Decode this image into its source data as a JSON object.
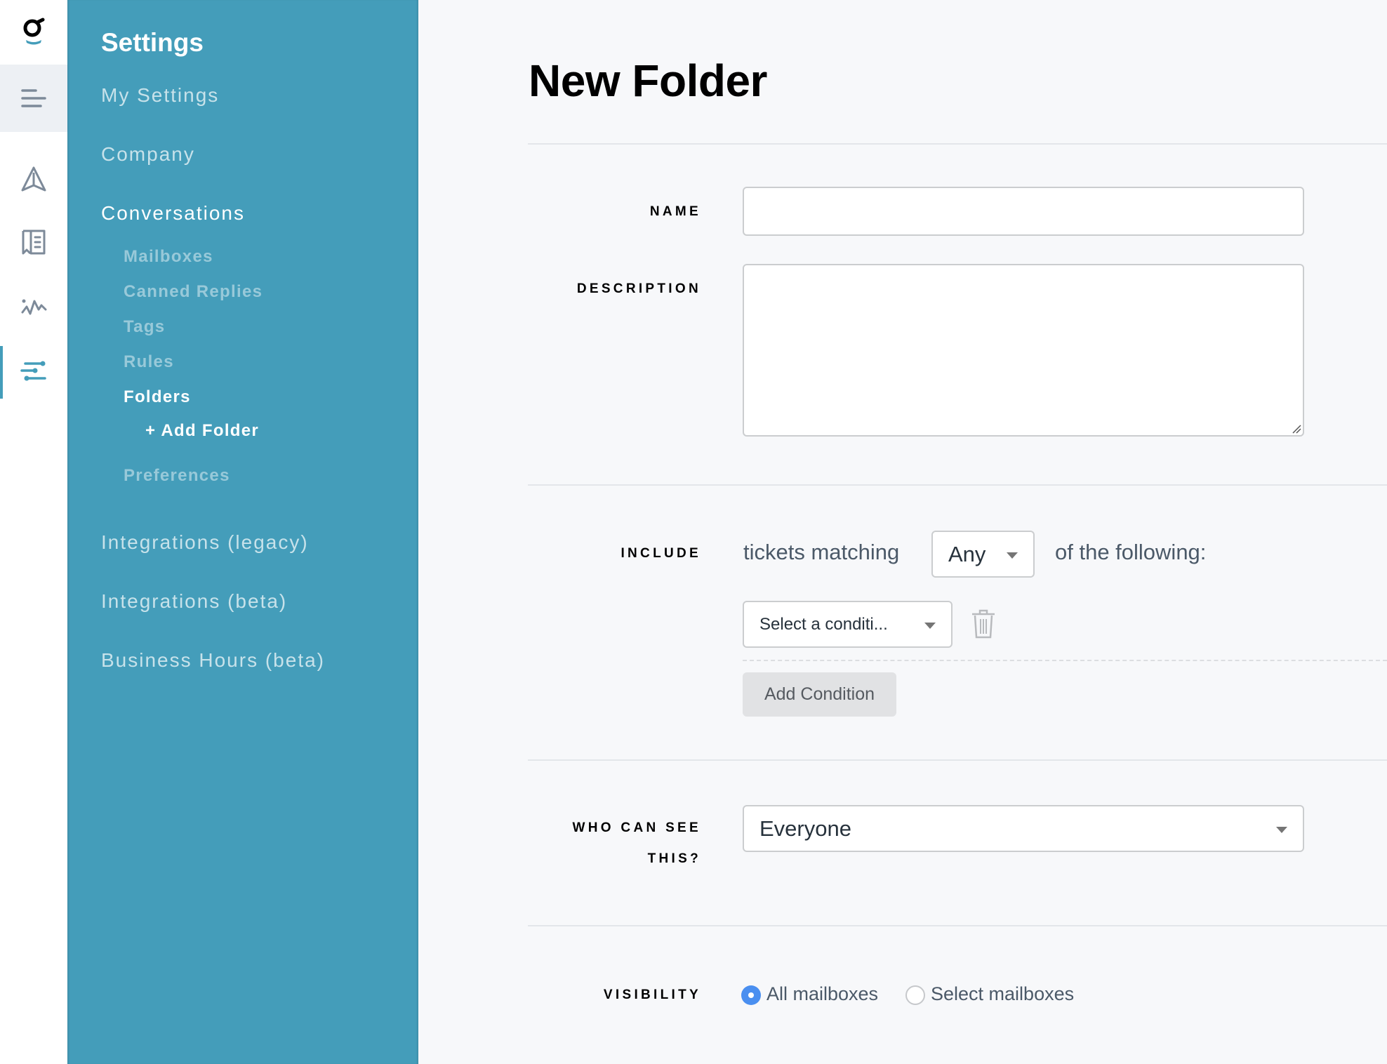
{
  "rail": {
    "logo": "app-logo",
    "icons": [
      "menu-icon",
      "send-icon",
      "knowledge-base-icon",
      "activity-icon",
      "settings-sliders-icon"
    ],
    "active": "settings-sliders-icon",
    "accent_color": "#449dba"
  },
  "sidebar": {
    "title": "Settings",
    "background_color": "#449dba",
    "items": [
      {
        "label": "My Settings"
      },
      {
        "label": "Company"
      },
      {
        "label": "Conversations",
        "expanded": true,
        "children": [
          {
            "label": "Mailboxes"
          },
          {
            "label": "Canned Replies"
          },
          {
            "label": "Tags"
          },
          {
            "label": "Rules"
          },
          {
            "label": "Folders",
            "active": true,
            "children": [
              {
                "label": "+ Add Folder"
              }
            ]
          },
          {
            "label": "Preferences"
          }
        ]
      },
      {
        "label": "Integrations (legacy)"
      },
      {
        "label": "Integrations (beta)"
      },
      {
        "label": "Business Hours (beta)"
      }
    ]
  },
  "main": {
    "title": "New Folder",
    "form": {
      "name": {
        "label": "NAME",
        "value": "",
        "placeholder": ""
      },
      "description": {
        "label": "DESCRIPTION",
        "value": "",
        "placeholder": ""
      },
      "include": {
        "label": "INCLUDE",
        "prefix": "tickets matching",
        "match_select": {
          "value": "Any"
        },
        "suffix": "of the following:",
        "conditions": [
          {
            "select_value": "Select a conditi..."
          }
        ],
        "add_condition_label": "Add Condition"
      },
      "who_can_see": {
        "label_line1": "WHO CAN SEE",
        "label_line2": "THIS?",
        "value": "Everyone"
      },
      "visibility": {
        "label": "VISIBILITY",
        "options": [
          {
            "label": "All mailboxes",
            "selected": true
          },
          {
            "label": "Select mailboxes",
            "selected": false
          }
        ],
        "selected_color": "#4a8ff0"
      }
    }
  }
}
